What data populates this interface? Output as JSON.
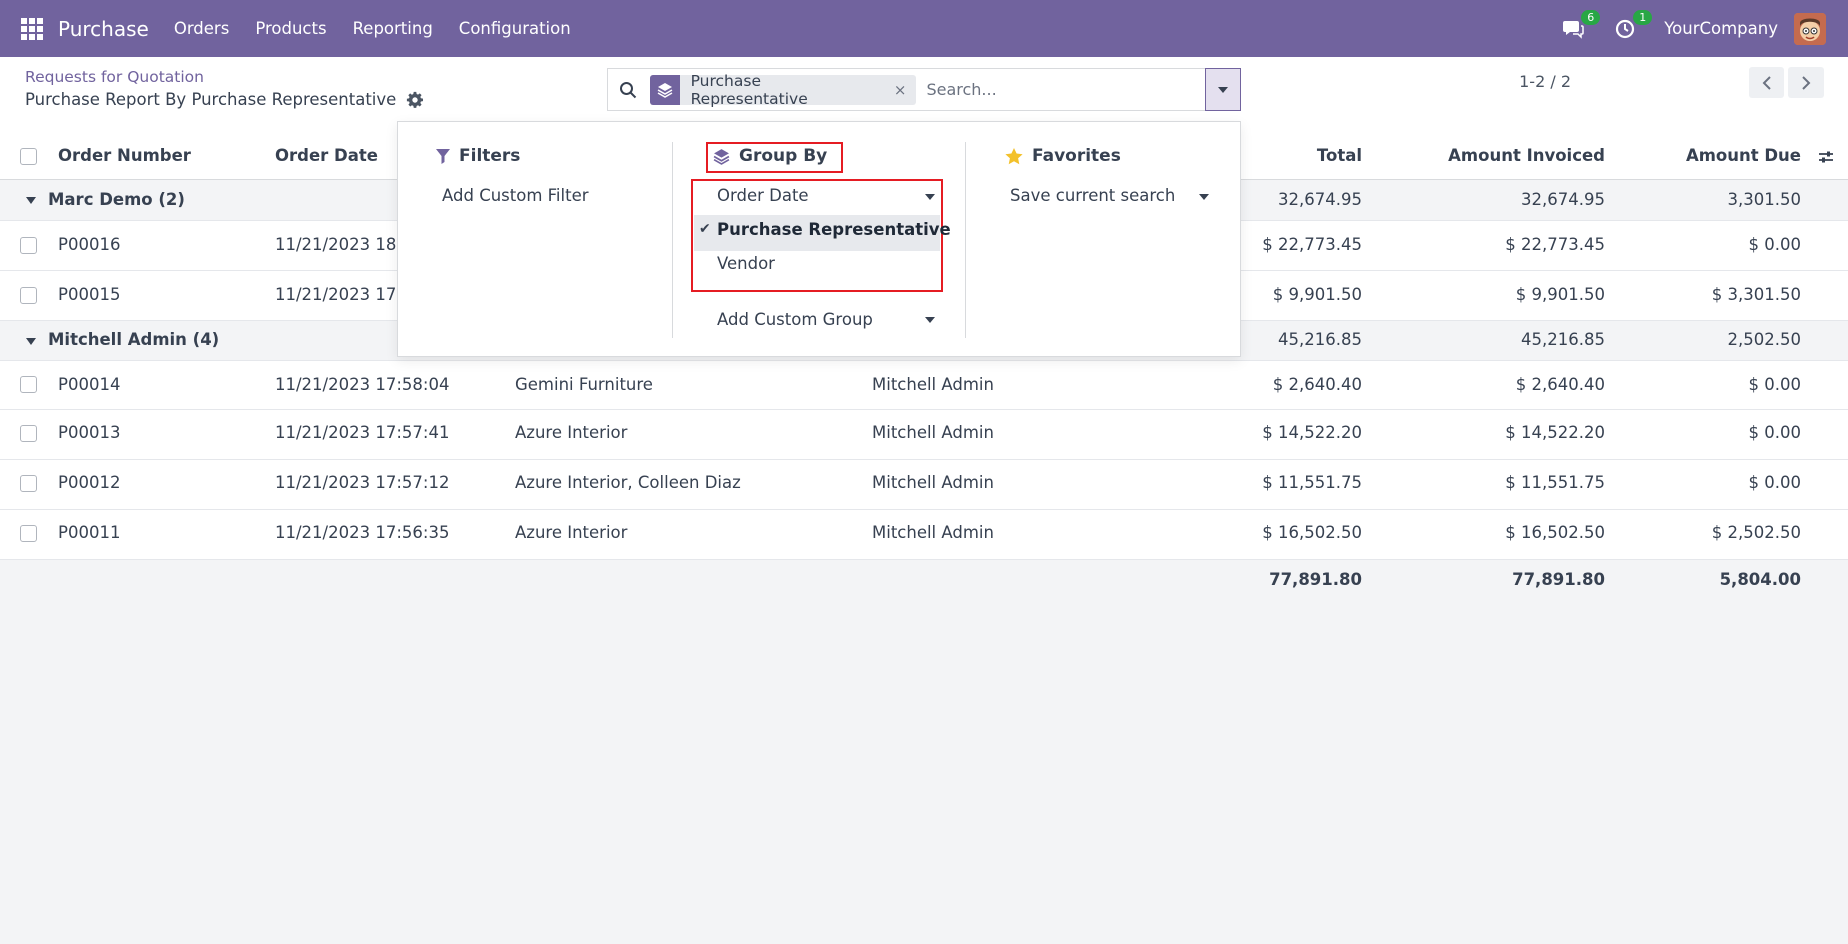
{
  "navbar": {
    "app_name": "Purchase",
    "menu": [
      "Orders",
      "Products",
      "Reporting",
      "Configuration"
    ],
    "messages_count": "6",
    "activities_count": "1",
    "company": "YourCompany",
    "color": "#71639e"
  },
  "control_panel": {
    "breadcrumb": "Requests for Quotation",
    "title": "Purchase Report By Purchase Representative",
    "facet_label": "Purchase Representative",
    "facet_remove": "×",
    "search_placeholder": "Search...",
    "pager": "1-2 / 2"
  },
  "table": {
    "headers": {
      "order_number": "Order Number",
      "order_date": "Order Date",
      "total": "Total",
      "amount_invoiced": "Amount Invoiced",
      "amount_due": "Amount Due"
    },
    "groups": [
      {
        "title": "Marc Demo (2)",
        "total": "32,674.95",
        "invoiced": "32,674.95",
        "due": "3,301.50",
        "rows": [
          {
            "number": "P00016",
            "date": "11/21/2023 18:",
            "vendor": "",
            "rep": "",
            "total": "$ 22,773.45",
            "invoiced": "$ 22,773.45",
            "due": "$ 0.00"
          },
          {
            "number": "P00015",
            "date": "11/21/2023 17:",
            "vendor": "",
            "rep": "",
            "total": "$ 9,901.50",
            "invoiced": "$ 9,901.50",
            "due": "$ 3,301.50"
          }
        ]
      },
      {
        "title": "Mitchell Admin (4)",
        "total": "45,216.85",
        "invoiced": "45,216.85",
        "due": "2,502.50",
        "rows": [
          {
            "number": "P00014",
            "date": "11/21/2023 17:58:04",
            "vendor": "Gemini Furniture",
            "rep": "Mitchell Admin",
            "total": "$ 2,640.40",
            "invoiced": "$ 2,640.40",
            "due": "$ 0.00"
          },
          {
            "number": "P00013",
            "date": "11/21/2023 17:57:41",
            "vendor": "Azure Interior",
            "rep": "Mitchell Admin",
            "total": "$ 14,522.20",
            "invoiced": "$ 14,522.20",
            "due": "$ 0.00"
          },
          {
            "number": "P00012",
            "date": "11/21/2023 17:57:12",
            "vendor": "Azure Interior, Colleen Diaz",
            "rep": "Mitchell Admin",
            "total": "$ 11,551.75",
            "invoiced": "$ 11,551.75",
            "due": "$ 0.00"
          },
          {
            "number": "P00011",
            "date": "11/21/2023 17:56:35",
            "vendor": "Azure Interior",
            "rep": "Mitchell Admin",
            "total": "$ 16,502.50",
            "invoiced": "$ 16,502.50",
            "due": "$ 2,502.50"
          }
        ]
      }
    ],
    "totals": {
      "total": "77,891.80",
      "invoiced": "77,891.80",
      "due": "5,804.00"
    }
  },
  "search_panel": {
    "filters": {
      "heading": "Filters",
      "add_custom": "Add Custom Filter"
    },
    "group_by": {
      "heading": "Group By",
      "options": [
        "Order Date",
        "Purchase Representative",
        "Vendor"
      ],
      "selected": "Purchase Representative",
      "add_custom": "Add Custom Group"
    },
    "favorites": {
      "heading": "Favorites",
      "save_search": "Save current search"
    },
    "highlight_color": "#e51c23"
  }
}
